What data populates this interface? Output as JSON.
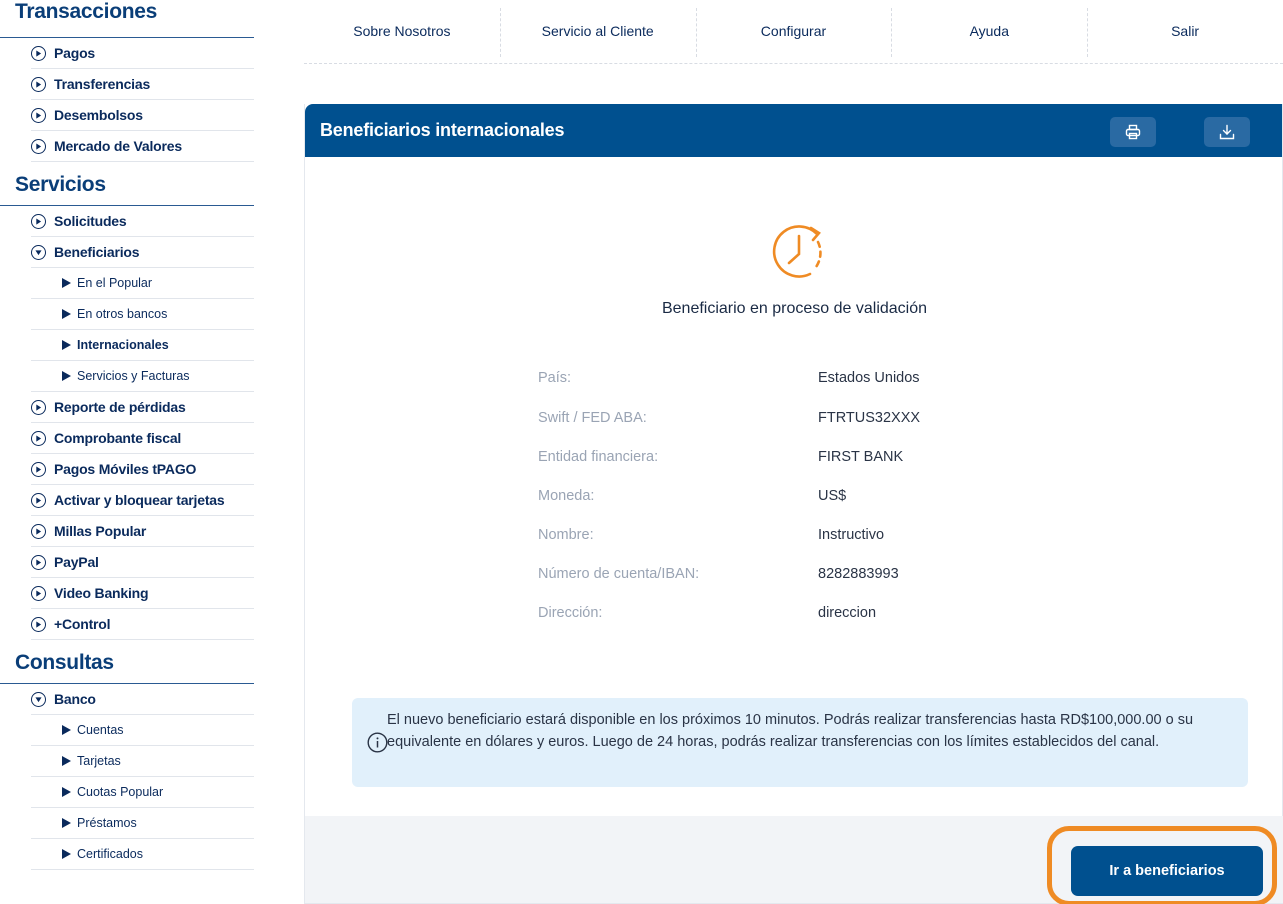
{
  "sidebar": {
    "sections": [
      {
        "title": "Transacciones"
      },
      {
        "title": "Servicios"
      },
      {
        "title": "Consultas"
      }
    ],
    "transacciones": [
      "Pagos",
      "Transferencias",
      "Desembolsos",
      "Mercado de Valores"
    ],
    "servicios": {
      "solicitudes": "Solicitudes",
      "beneficiarios": "Beneficiarios",
      "beneficiarios_sub": [
        "En el Popular",
        "En otros bancos",
        "Internacionales",
        "Servicios y Facturas"
      ],
      "rest": [
        "Reporte de pérdidas",
        "Comprobante fiscal",
        "Pagos Móviles tPAGO",
        "Activar y bloquear tarjetas",
        "Millas Popular",
        "PayPal",
        "Video Banking",
        "+Control"
      ]
    },
    "consultas": {
      "banco": "Banco",
      "banco_sub": [
        "Cuentas",
        "Tarjetas",
        "Cuotas Popular",
        "Préstamos",
        "Certificados"
      ]
    }
  },
  "topnav": [
    "Sobre Nosotros",
    "Servicio al Cliente",
    "Configurar",
    "Ayuda",
    "Salir"
  ],
  "card": {
    "title": "Beneficiarios internacionales",
    "status": "Beneficiario en proceso de validación",
    "details": [
      {
        "k": "País:",
        "v": "Estados Unidos"
      },
      {
        "k": "Swift / FED ABA:",
        "v": "FTRTUS32XXX"
      },
      {
        "k": "Entidad financiera:",
        "v": "FIRST BANK"
      },
      {
        "k": "Moneda:",
        "v": "US$"
      },
      {
        "k": "Nombre:",
        "v": "Instructivo"
      },
      {
        "k": "Número de cuenta/IBAN:",
        "v": "8282883993"
      },
      {
        "k": "Dirección:",
        "v": "direccion"
      }
    ],
    "notice": "El nuevo beneficiario estará disponible en los próximos 10 minutos. Podrás realizar transferencias hasta RD$100,000.00 o su equivalente en dólares y euros. Luego de 24 horas, podrás realizar transferencias con los límites establecidos del canal.",
    "button": "Ir a beneficiarios"
  },
  "colors": {
    "brand": "#00508f",
    "accent": "#ef8b24",
    "notice_bg": "#e1f0fb"
  },
  "icons": [
    "print-icon",
    "download-icon",
    "clock-icon",
    "info-icon"
  ]
}
